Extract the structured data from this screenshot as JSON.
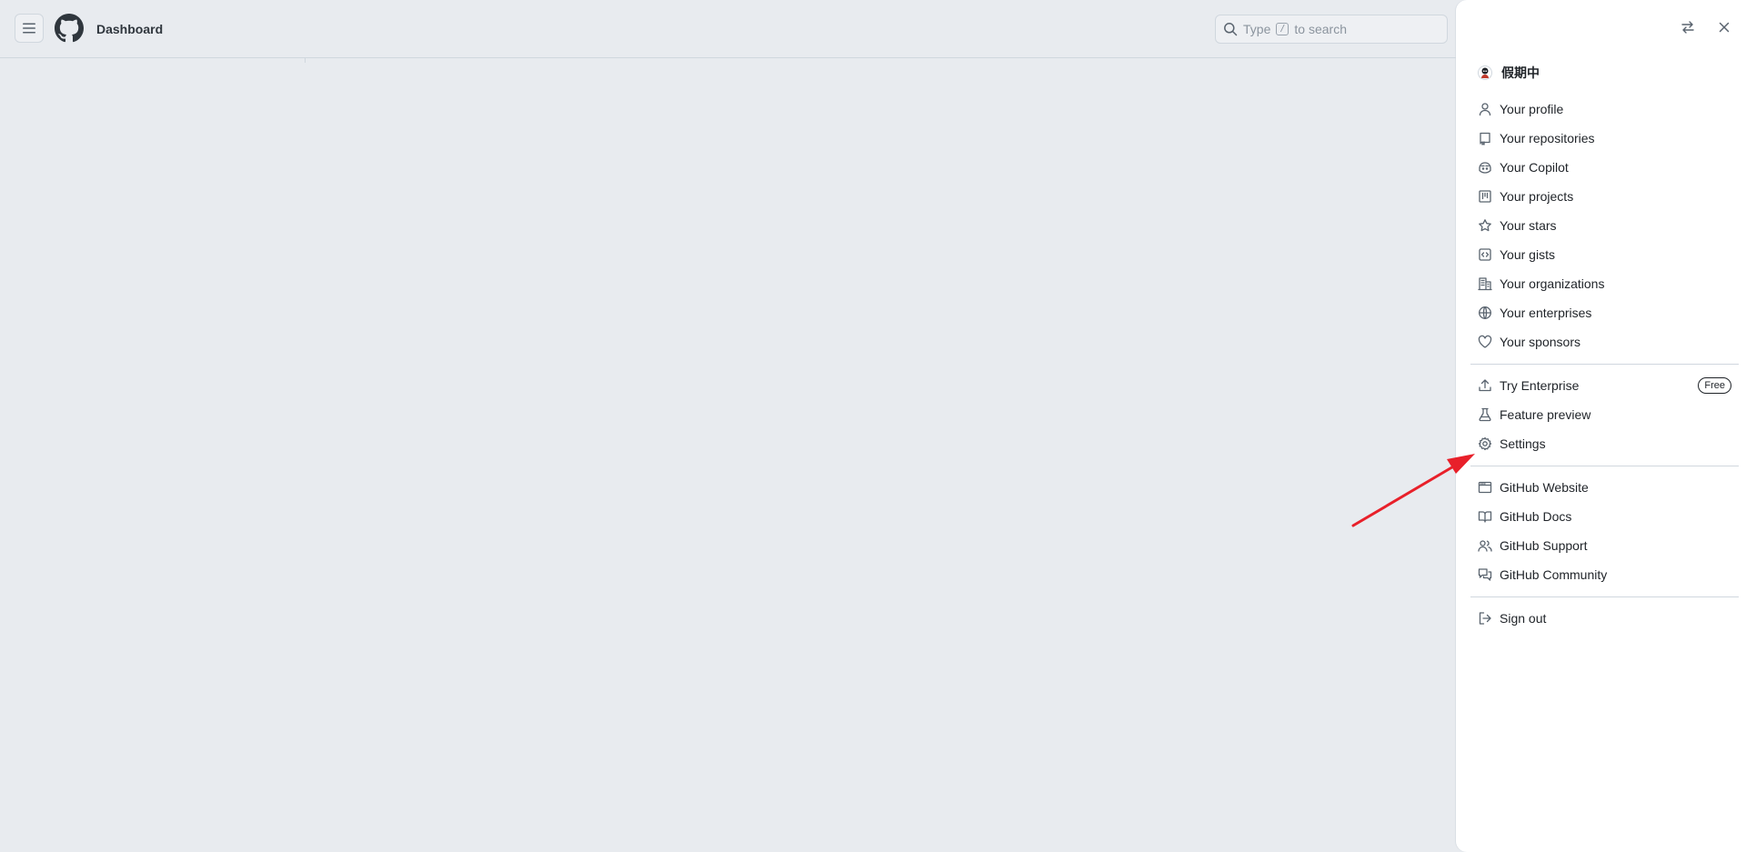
{
  "header": {
    "title": "Dashboard",
    "search_prefix": "Type",
    "search_key": "/",
    "search_suffix": "to search"
  },
  "drawer": {
    "username": "假期中",
    "groups": [
      [
        {
          "label": "Your profile",
          "icon": "person-icon"
        },
        {
          "label": "Your repositories",
          "icon": "repo-icon"
        },
        {
          "label": "Your Copilot",
          "icon": "copilot-icon"
        },
        {
          "label": "Your projects",
          "icon": "project-icon"
        },
        {
          "label": "Your stars",
          "icon": "star-icon"
        },
        {
          "label": "Your gists",
          "icon": "code-square-icon"
        },
        {
          "label": "Your organizations",
          "icon": "organization-icon"
        },
        {
          "label": "Your enterprises",
          "icon": "globe-icon"
        },
        {
          "label": "Your sponsors",
          "icon": "heart-icon"
        }
      ],
      [
        {
          "label": "Try Enterprise",
          "icon": "upload-icon",
          "badge": "Free"
        },
        {
          "label": "Feature preview",
          "icon": "beaker-icon"
        },
        {
          "label": "Settings",
          "icon": "gear-icon"
        }
      ],
      [
        {
          "label": "GitHub Website",
          "icon": "browser-icon"
        },
        {
          "label": "GitHub Docs",
          "icon": "book-icon"
        },
        {
          "label": "GitHub Support",
          "icon": "people-icon"
        },
        {
          "label": "GitHub Community",
          "icon": "comment-discussion-icon"
        }
      ],
      [
        {
          "label": "Sign out",
          "icon": "sign-out-icon"
        }
      ]
    ]
  },
  "colors": {
    "background": "#e8ebef",
    "drawer": "#ffffff",
    "annotation_arrow": "#e8202a"
  }
}
